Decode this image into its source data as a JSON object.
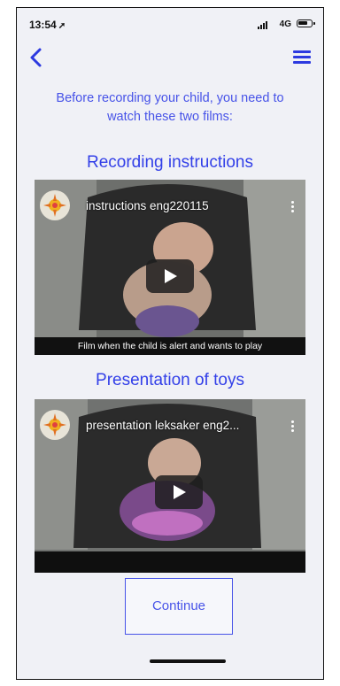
{
  "status_bar": {
    "time": "13:54",
    "network": "4G"
  },
  "header": {
    "back_icon": "chevron-left-icon",
    "menu_icon": "hamburger-icon"
  },
  "intro_text": "Before recording your child, you need to watch these two films:",
  "sections": [
    {
      "title": "Recording instructions",
      "video": {
        "title": "instructions eng220115",
        "caption": "Film when the child is alert and wants to play"
      }
    },
    {
      "title": "Presentation of toys",
      "video": {
        "title": "presentation leksaker eng2..."
      }
    }
  ],
  "continue_label": "Continue",
  "colors": {
    "accent": "#3340e8",
    "background": "#f0f1f6"
  }
}
